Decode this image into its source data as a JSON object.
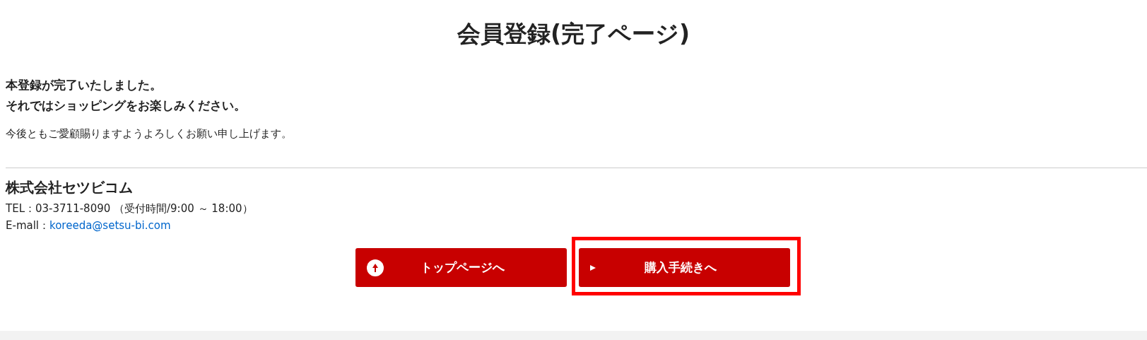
{
  "title": "会員登録(完了ページ)",
  "lead": [
    "本登録が完了いたしました。",
    "それではショッピングをお楽しみください。"
  ],
  "message": "今後ともご愛顧賜りますようよろしくお願い申し上げます。",
  "company": {
    "name": "株式会社セツビコム",
    "tel": "TEL：03-3711-8090 （受付時間/9:00 ～ 18:00）",
    "email_label": "E-mall：",
    "email": "koreeda@setsu-bi.com"
  },
  "buttons": [
    {
      "label": "トップページへ",
      "kind": "up-circle",
      "highlighted": false
    },
    {
      "label": "購入手続きへ",
      "kind": "triangle",
      "highlighted": true
    }
  ]
}
